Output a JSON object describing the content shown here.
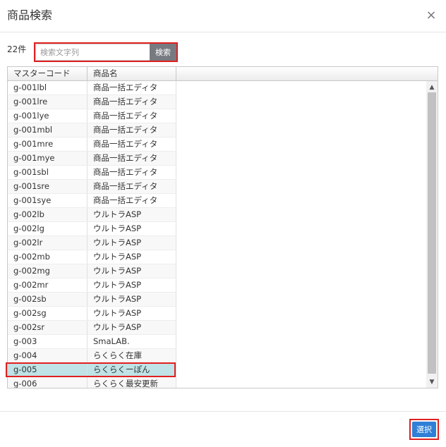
{
  "dialog": {
    "title": "商品検索",
    "close_glyph": "×"
  },
  "search": {
    "count": "22件",
    "placeholder": "検索文字列",
    "value": "",
    "button_label": "検索"
  },
  "table": {
    "columns": [
      "マスターコード",
      "商品名"
    ],
    "rows": [
      {
        "code": "g-001lbl",
        "name": "商品一括エディタ"
      },
      {
        "code": "g-001lre",
        "name": "商品一括エディタ"
      },
      {
        "code": "g-001lye",
        "name": "商品一括エディタ"
      },
      {
        "code": "g-001mbl",
        "name": "商品一括エディタ"
      },
      {
        "code": "g-001mre",
        "name": "商品一括エディタ"
      },
      {
        "code": "g-001mye",
        "name": "商品一括エディタ"
      },
      {
        "code": "g-001sbl",
        "name": "商品一括エディタ"
      },
      {
        "code": "g-001sre",
        "name": "商品一括エディタ"
      },
      {
        "code": "g-001sye",
        "name": "商品一括エディタ"
      },
      {
        "code": "g-002lb",
        "name": "ウルトラASP"
      },
      {
        "code": "g-002lg",
        "name": "ウルトラASP"
      },
      {
        "code": "g-002lr",
        "name": "ウルトラASP"
      },
      {
        "code": "g-002mb",
        "name": "ウルトラASP"
      },
      {
        "code": "g-002mg",
        "name": "ウルトラASP"
      },
      {
        "code": "g-002mr",
        "name": "ウルトラASP"
      },
      {
        "code": "g-002sb",
        "name": "ウルトラASP"
      },
      {
        "code": "g-002sg",
        "name": "ウルトラASP"
      },
      {
        "code": "g-002sr",
        "name": "ウルトラASP"
      },
      {
        "code": "g-003",
        "name": "SmaLAB."
      },
      {
        "code": "g-004",
        "name": "らくらく在庫"
      },
      {
        "code": "g-005",
        "name": "らくらくーぽん",
        "selected": true
      },
      {
        "code": "g-006",
        "name": "らくらく最安更新"
      }
    ],
    "scroll_up_glyph": "▲",
    "scroll_down_glyph": "▼"
  },
  "footer": {
    "select_label": "選択"
  },
  "colors": {
    "highlight": "#e02020",
    "selected_row": "#bfe3e6",
    "primary": "#2f7fd6",
    "search_button": "#777a80"
  }
}
